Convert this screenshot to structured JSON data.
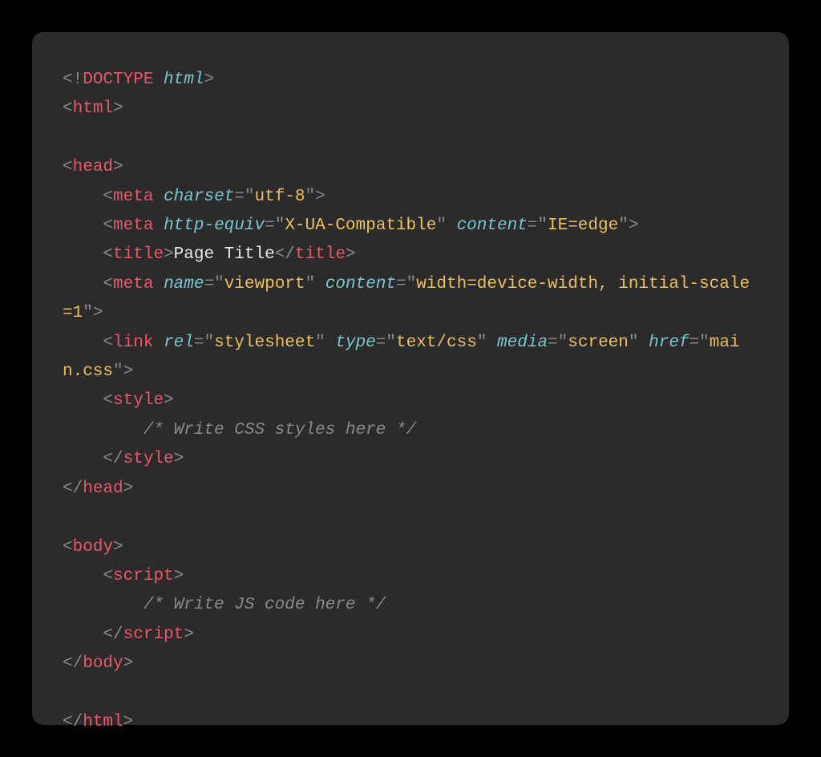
{
  "code": {
    "doctype_bang": "!",
    "doctype_word": "DOCTYPE",
    "doctype_html": "html",
    "tag_html": "html",
    "tag_head": "head",
    "tag_meta": "meta",
    "attr_charset": "charset",
    "val_utf8": "utf-8",
    "attr_httpEquiv": "http-equiv",
    "val_xua": "X-UA-Compatible",
    "attr_content": "content",
    "val_ieedge": "IE=edge",
    "tag_title": "title",
    "title_text": "Page Title",
    "attr_name": "name",
    "val_viewport": "viewport",
    "val_viewport_content_a": "width=device-width, initial-scale=1",
    "tag_link": "link",
    "attr_rel": "rel",
    "val_stylesheet": "stylesheet",
    "attr_type": "type",
    "val_textcss": "text/css",
    "attr_media": "media",
    "val_screen": "screen",
    "attr_href": "href",
    "val_maincss": "main.css",
    "tag_style": "style",
    "css_comment": "/* Write CSS styles here */",
    "tag_body": "body",
    "tag_script": "script",
    "js_comment": "/* Write JS code here */"
  }
}
